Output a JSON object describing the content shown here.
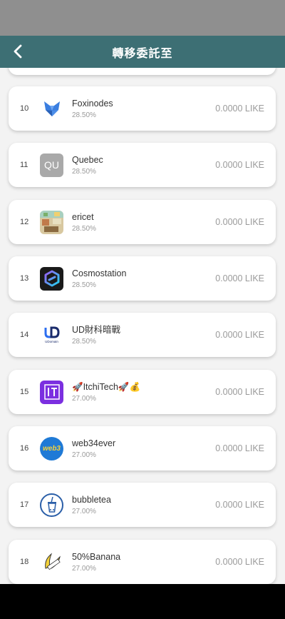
{
  "header": {
    "title": "轉移委託至"
  },
  "validators": [
    {
      "rank": "10",
      "name": "Foxinodes",
      "percent": "28.50%",
      "amount": "0.0000 LIKE",
      "icon": "fox-icon"
    },
    {
      "rank": "11",
      "name": "Quebec",
      "percent": "28.50%",
      "amount": "0.0000 LIKE",
      "icon": "qu-icon",
      "icon_text": "QU"
    },
    {
      "rank": "12",
      "name": "ericet",
      "percent": "28.50%",
      "amount": "0.0000 LIKE",
      "icon": "pixel-room-icon"
    },
    {
      "rank": "13",
      "name": "Cosmostation",
      "percent": "28.50%",
      "amount": "0.0000 LIKE",
      "icon": "cosmostation-icon"
    },
    {
      "rank": "14",
      "name": "UD財科暗戰",
      "percent": "28.50%",
      "amount": "0.0000 LIKE",
      "icon": "udomain-icon",
      "icon_text": "UDomain"
    },
    {
      "rank": "15",
      "name": "🚀ItchiTech🚀💰",
      "percent": "27.00%",
      "amount": "0.0000 LIKE",
      "icon": "itchitech-icon"
    },
    {
      "rank": "16",
      "name": "web34ever",
      "percent": "27.00%",
      "amount": "0.0000 LIKE",
      "icon": "web3-icon",
      "icon_text": "web3"
    },
    {
      "rank": "17",
      "name": "bubbletea",
      "percent": "27.00%",
      "amount": "0.0000 LIKE",
      "icon": "bubbletea-icon"
    },
    {
      "rank": "18",
      "name": "50%Banana",
      "percent": "27.00%",
      "amount": "0.0000 LIKE",
      "icon": "banana-icon"
    }
  ]
}
